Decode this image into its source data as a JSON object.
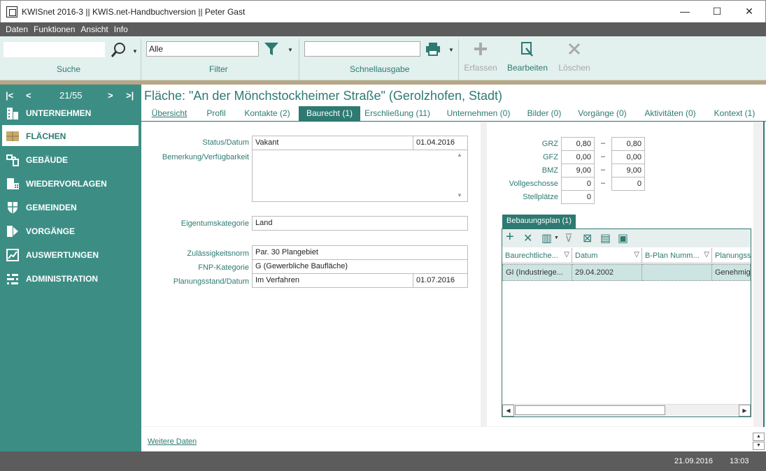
{
  "window": {
    "title": "KWISnet 2016-3 || KWIS.net-Handbuchversion || Peter Gast",
    "minimize_glyph": "—",
    "maximize_glyph": "☐",
    "close_glyph": "✕"
  },
  "menu": [
    "Daten",
    "Funktionen",
    "Ansicht",
    "Info"
  ],
  "ribbon": {
    "search": {
      "label": "Suche",
      "value": ""
    },
    "filter": {
      "label": "Filter",
      "value": "Alle"
    },
    "quick_output": {
      "label": "Schnellausgabe",
      "value": ""
    },
    "actions": [
      {
        "label": "Erfassen",
        "icon": "plus-icon",
        "enabled": false
      },
      {
        "label": "Bearbeiten",
        "icon": "edit-icon",
        "enabled": true
      },
      {
        "label": "Löschen",
        "icon": "delete-icon",
        "enabled": false
      }
    ]
  },
  "navigator": {
    "position": "21/55",
    "items": [
      {
        "label": "UNTERNEHMEN",
        "icon": "building-icon",
        "selected": false
      },
      {
        "label": "FLÄCHEN",
        "icon": "area-icon",
        "selected": true
      },
      {
        "label": "GEBÄUDE",
        "icon": "building-structure-icon",
        "selected": false
      },
      {
        "label": "WIEDERVORLAGEN",
        "icon": "calendar-icon",
        "selected": false
      },
      {
        "label": "GEMEINDEN",
        "icon": "shield-icon",
        "selected": false
      },
      {
        "label": "VORGÄNGE",
        "icon": "process-icon",
        "selected": false
      },
      {
        "label": "AUSWERTUNGEN",
        "icon": "chart-icon",
        "selected": false
      },
      {
        "label": "ADMINISTRATION",
        "icon": "settings-icon",
        "selected": false
      }
    ]
  },
  "record": {
    "title": "Fläche: \"An der Mönchstockheimer Straße\" (Gerolzhofen, Stadt)"
  },
  "tabs": [
    {
      "label": "Übersicht"
    },
    {
      "label": "Profil"
    },
    {
      "label": "Kontakte (2)"
    },
    {
      "label": "Baurecht (1)",
      "selected": true
    },
    {
      "label": "Erschließung (11)"
    },
    {
      "label": "Unternehmen (0)"
    },
    {
      "label": "Bilder (0)"
    },
    {
      "label": "Vorgänge (0)"
    },
    {
      "label": "Aktivitäten (0)"
    },
    {
      "label": "Kontext (1)"
    }
  ],
  "form": {
    "status_label": "Status/Datum",
    "status_value": "Vakant",
    "status_date": "01.04.2016",
    "remark_label": "Bemerkung/Verfügbarkeit",
    "remark_value": "",
    "ownership_label": "Eigentumskategorie",
    "ownership_value": "Land",
    "zoning_label": "Zulässigkeitsnorm",
    "zoning_value": "Par. 30 Plangebiet",
    "fnp_label": "FNP-Kategorie",
    "fnp_value": "G (Gewerbliche Baufläche)",
    "planning_label": "Planungsstand/Datum",
    "planning_value": "Im Verfahren",
    "planning_date": "01.07.2016"
  },
  "metrics": [
    {
      "label": "GRZ",
      "from": "0,80",
      "to": "0,80"
    },
    {
      "label": "GFZ",
      "from": "0,00",
      "to": "0,00"
    },
    {
      "label": "BMZ",
      "from": "9,00",
      "to": "9,00"
    },
    {
      "label": "Vollgeschosse",
      "from": "0",
      "to": "0"
    },
    {
      "label": "Stellplätze",
      "from": "0",
      "to": null
    }
  ],
  "dash": "–",
  "bplan": {
    "tab_label": "Bebauungsplan (1)",
    "columns": [
      "Baurechtliche...",
      "Datum",
      "B-Plan  Numm...",
      "Planungss"
    ],
    "rows": [
      [
        "GI (Industriege...",
        "29.04.2002",
        "",
        "Genehmig"
      ]
    ]
  },
  "footer": {
    "more_data_link": "Weitere Daten"
  },
  "status": {
    "date": "21.09.2016",
    "time": "13:03"
  }
}
